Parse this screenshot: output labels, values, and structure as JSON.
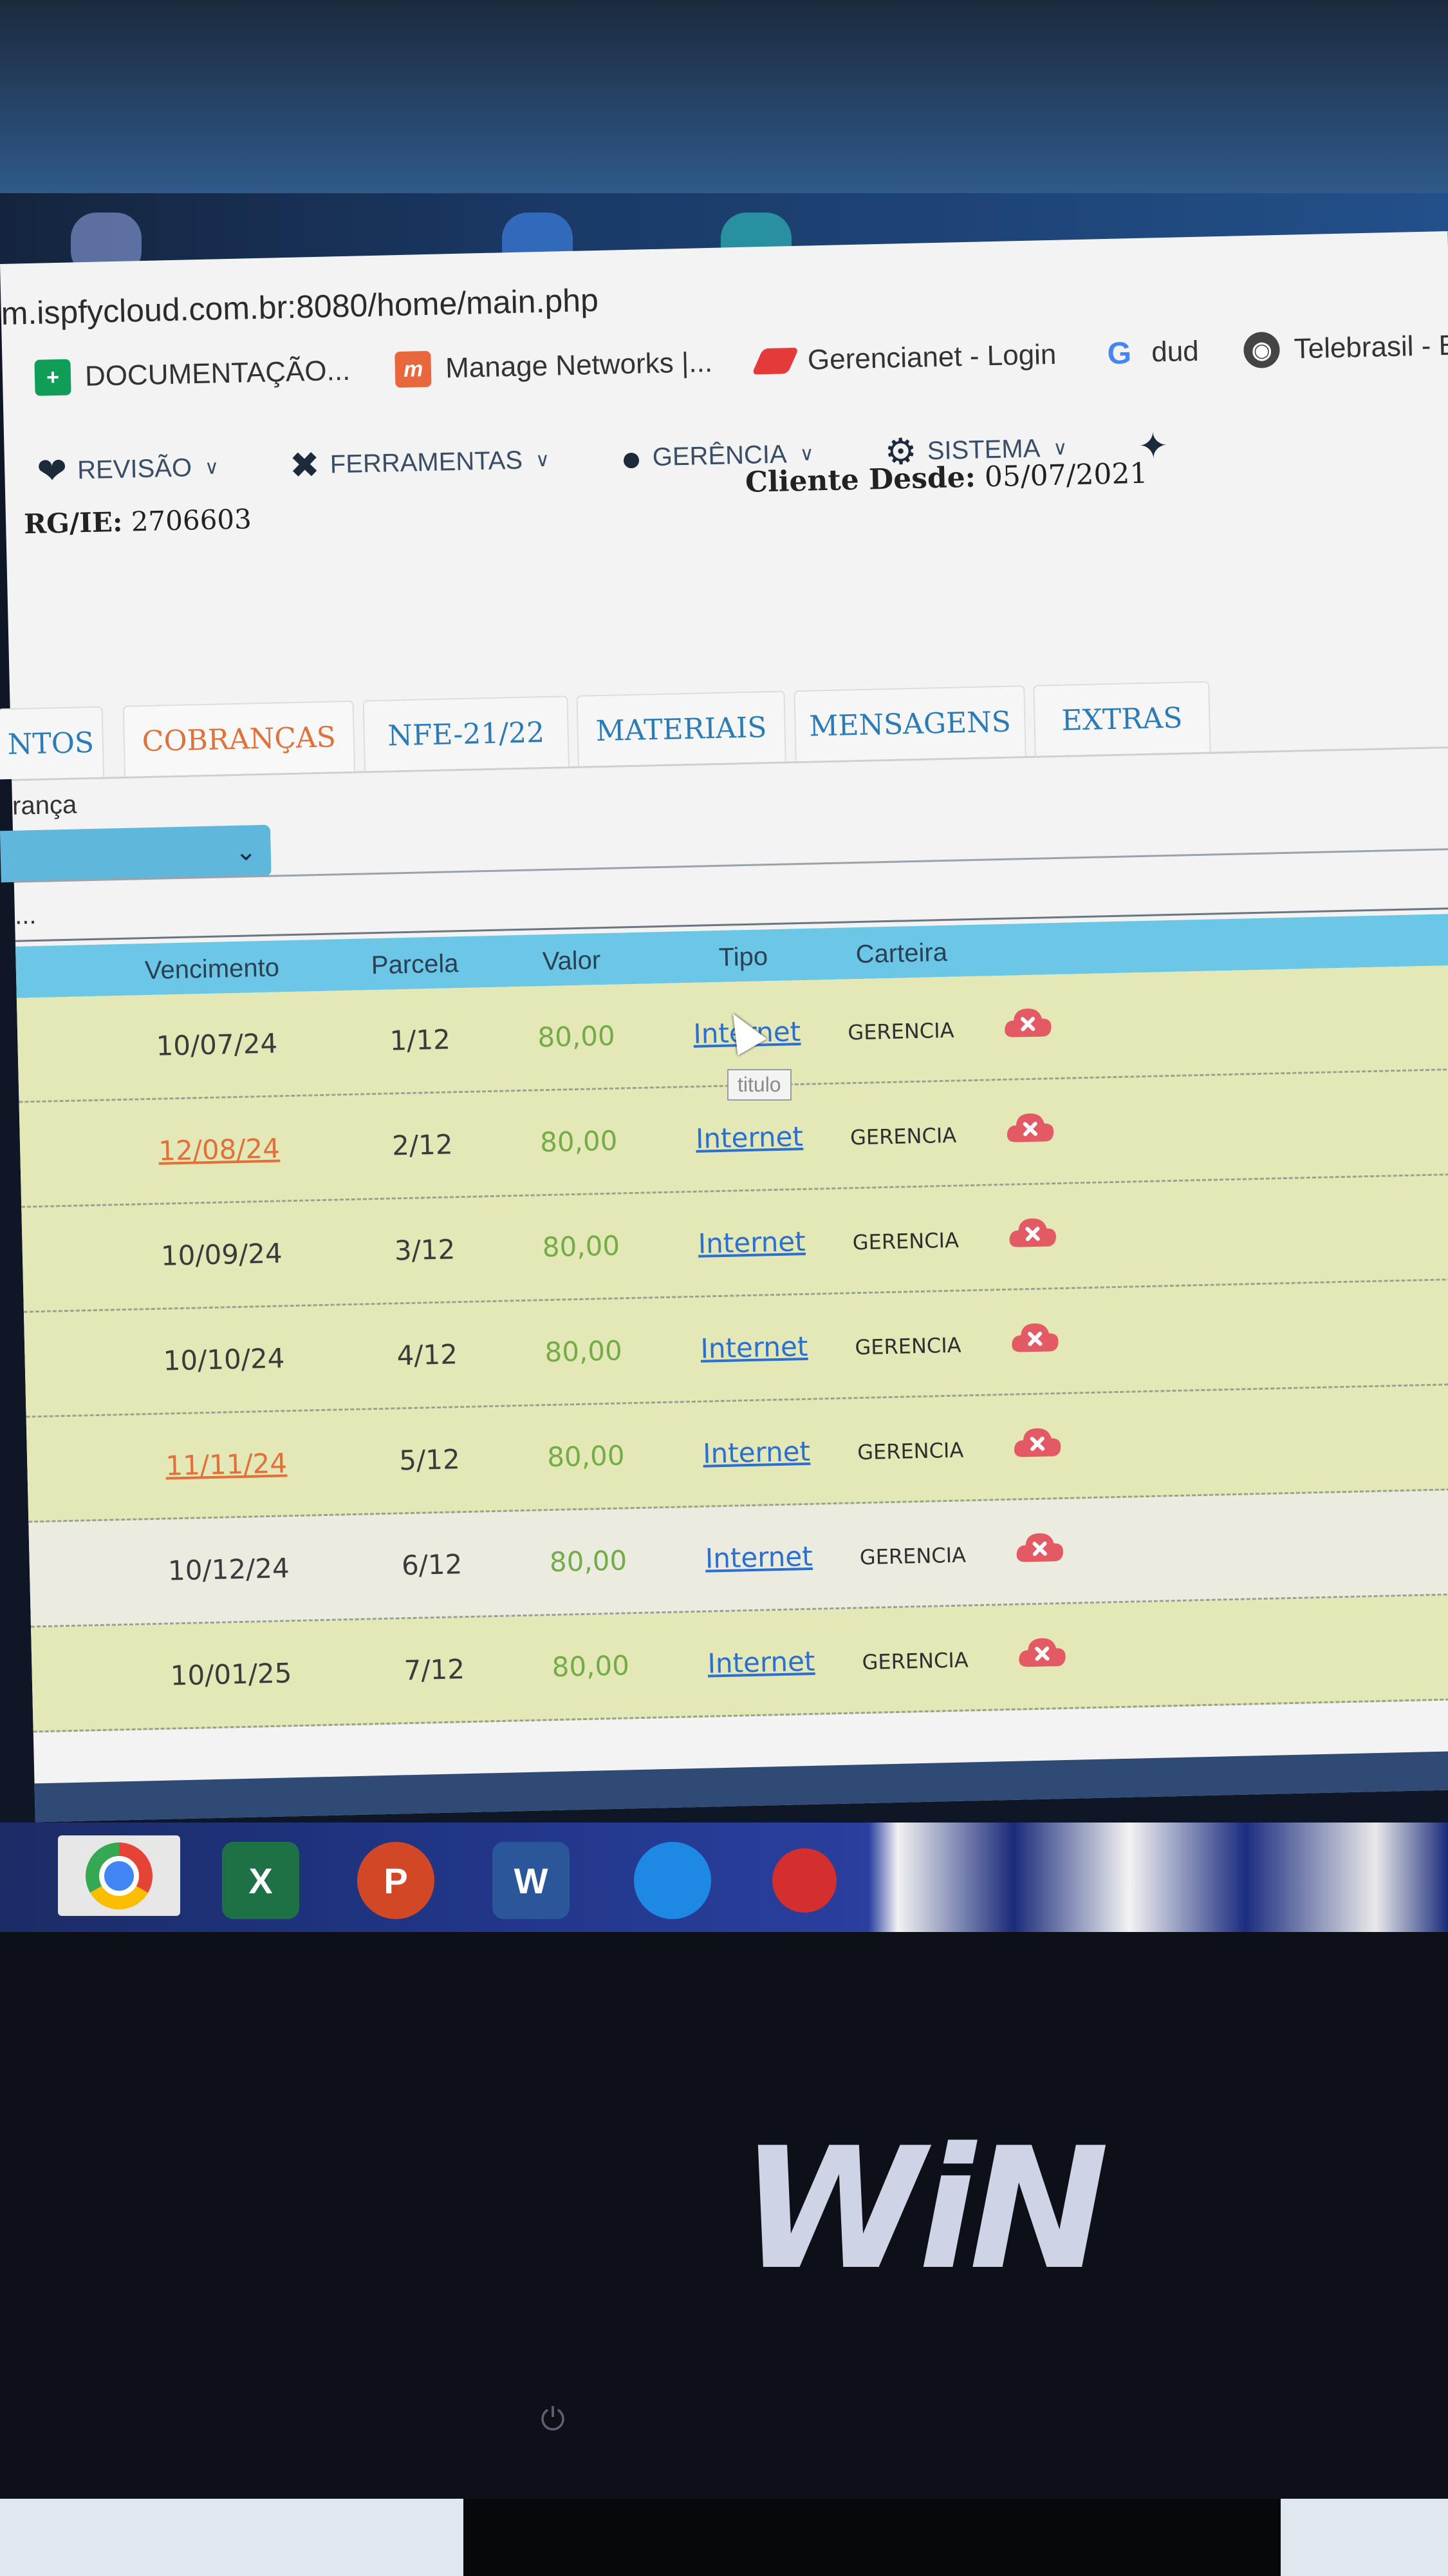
{
  "browser": {
    "url": "m.ispfycloud.com.br:8080/home/main.php",
    "bookmarks": [
      {
        "label": "DOCUMENTAÇÃO...",
        "icon": "sheets-icon",
        "color": "#0f9d58"
      },
      {
        "label": "Manage Networks |...",
        "icon": "m-logo-icon",
        "color": "#e8673c"
      },
      {
        "label": "Gerencianet - Login",
        "icon": "gerencianet-icon",
        "color": "#e53a3a"
      },
      {
        "label": "dud",
        "icon": "google-icon",
        "color": "#4285f4"
      },
      {
        "label": "Telebrasil - ERBS -...",
        "icon": "globe-icon",
        "color": "#444"
      }
    ]
  },
  "menu": {
    "items": [
      {
        "label": "REVISÃO",
        "icon": "heart-check-icon"
      },
      {
        "label": "FERRAMENTAS",
        "icon": "tools-icon"
      },
      {
        "label": "GERÊNCIA",
        "icon": "user-gear-icon"
      },
      {
        "label": "SISTEMA",
        "icon": "gear-icon"
      }
    ],
    "magic_icon": "magic-wand-icon"
  },
  "client": {
    "rg_label": "RG/IE:",
    "rg_value": "2706603",
    "since_label": "Cliente Desde:",
    "since_value": "05/07/2021"
  },
  "tabs": [
    {
      "label": "NTOS",
      "active": false
    },
    {
      "label": "COBRANÇAS",
      "active": true
    },
    {
      "label": "NFE-21/22",
      "active": false
    },
    {
      "label": "MATERIAIS",
      "active": false
    },
    {
      "label": "MENSAGENS",
      "active": false
    },
    {
      "label": "EXTRAS",
      "active": false
    }
  ],
  "filter": {
    "label": "rança",
    "selected": "",
    "dots": "..."
  },
  "table": {
    "columns": [
      "Vencimento",
      "Parcela",
      "Valor",
      "Tipo",
      "Carteira"
    ],
    "rows": [
      {
        "vencimento": "10/07/24",
        "parcela": "1/12",
        "valor": "80,00",
        "tipo": "Internet",
        "carteira": "GERENCIA",
        "late": false
      },
      {
        "vencimento": "12/08/24",
        "parcela": "2/12",
        "valor": "80,00",
        "tipo": "Internet",
        "carteira": "GERENCIA",
        "late": true
      },
      {
        "vencimento": "10/09/24",
        "parcela": "3/12",
        "valor": "80,00",
        "tipo": "Internet",
        "carteira": "GERENCIA",
        "late": false
      },
      {
        "vencimento": "10/10/24",
        "parcela": "4/12",
        "valor": "80,00",
        "tipo": "Internet",
        "carteira": "GERENCIA",
        "late": false
      },
      {
        "vencimento": "11/11/24",
        "parcela": "5/12",
        "valor": "80,00",
        "tipo": "Internet",
        "carteira": "GERENCIA",
        "late": true
      },
      {
        "vencimento": "10/12/24",
        "parcela": "6/12",
        "valor": "80,00",
        "tipo": "Internet",
        "carteira": "GERENCIA",
        "late": false
      },
      {
        "vencimento": "10/01/25",
        "parcela": "7/12",
        "valor": "80,00",
        "tipo": "Internet",
        "carteira": "GERENCIA",
        "late": false
      }
    ]
  },
  "tooltip": "titulo",
  "taskbar": {
    "apps": [
      {
        "name": "chrome-icon"
      },
      {
        "name": "excel-icon",
        "letter": "X",
        "color": "#1e7145"
      },
      {
        "name": "powerpoint-icon",
        "letter": "P",
        "color": "#d24726"
      },
      {
        "name": "word-icon",
        "letter": "W",
        "color": "#2b579a"
      },
      {
        "name": "winbox-icon",
        "color": "#1e88e5"
      },
      {
        "name": "app-red-icon",
        "color": "#d32f2f"
      }
    ]
  },
  "monitor": {
    "logo": "WiN",
    "power_symbol": "⏻"
  },
  "colors": {
    "accent_tab": "#e2703a",
    "link": "#2a6fd1",
    "header_bg": "#6cc7e6",
    "row_bg": "#e4e8b6",
    "value_green": "#74ad47"
  }
}
